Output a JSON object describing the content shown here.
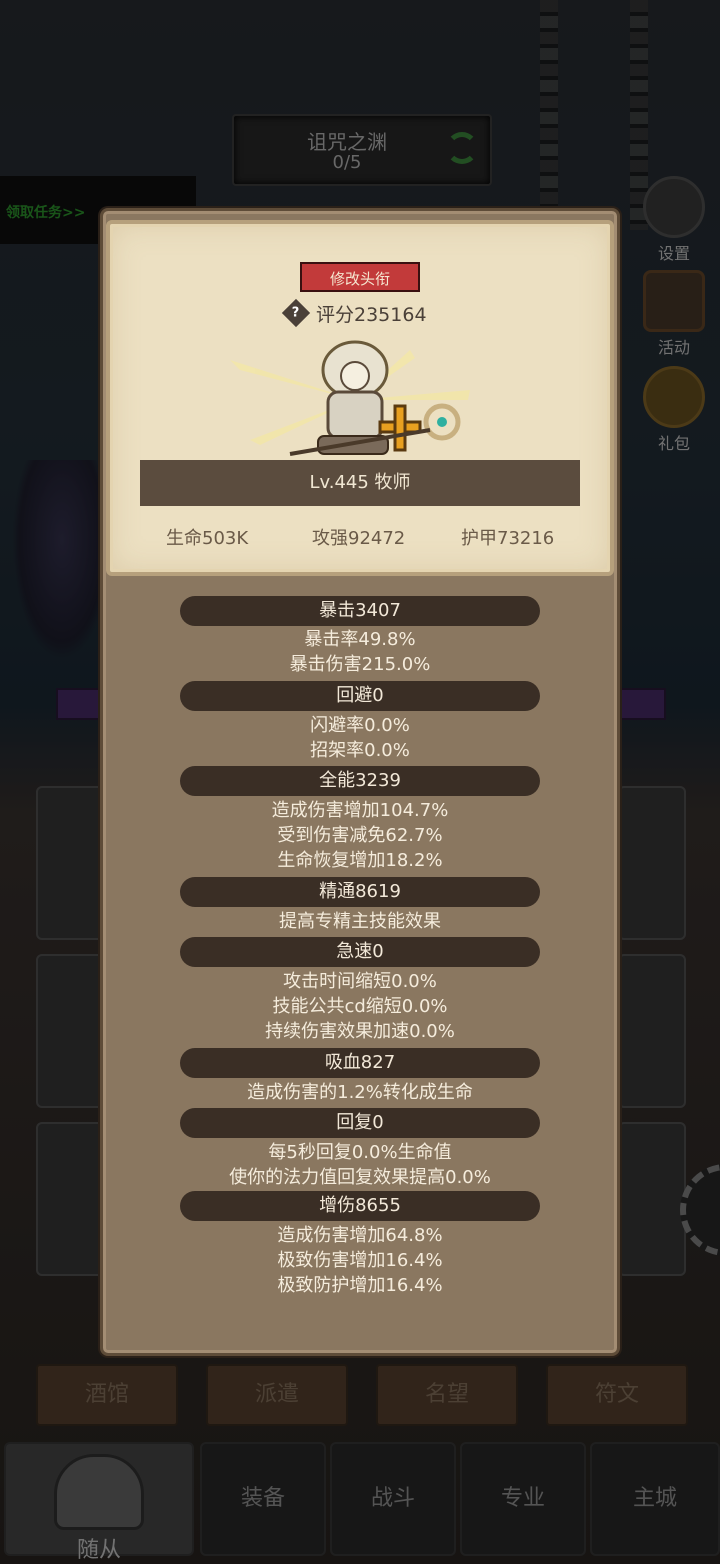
{
  "quest": {
    "title": "诅咒之渊",
    "progress": "0/5",
    "accept_label": "领取任务>>"
  },
  "side_menu": [
    {
      "label": "设置",
      "icon": "gear-icon"
    },
    {
      "label": "活动",
      "icon": "activity-icon"
    },
    {
      "label": "礼包",
      "icon": "gift-icon"
    }
  ],
  "hero": {
    "rename_label": "修改头衔",
    "score": "评分235164",
    "level_class": "Lv.445 牧师",
    "life": "生命503K",
    "attack": "攻强92472",
    "armor": "护甲73216"
  },
  "sections": [
    {
      "title": "暴击3407",
      "lines": [
        "暴击率49.8%",
        "暴击伤害215.0%"
      ]
    },
    {
      "title": "回避0",
      "lines": [
        "闪避率0.0%",
        "招架率0.0%"
      ]
    },
    {
      "title": "全能3239",
      "lines": [
        "造成伤害增加104.7%",
        "受到伤害减免62.7%",
        "生命恢复增加18.2%"
      ]
    },
    {
      "title": "精通8619",
      "lines": [
        "提高专精主技能效果"
      ]
    },
    {
      "title": "急速0",
      "lines": [
        "攻击时间缩短0.0%",
        "技能公共cd缩短0.0%",
        "持续伤害效果加速0.0%"
      ]
    },
    {
      "title": "吸血827",
      "lines": [
        "造成伤害的1.2%转化成生命"
      ]
    },
    {
      "title": "回复0",
      "lines": [
        "每5秒回复0.0%生命值",
        "使你的法力值回复效果提高0.0%"
      ]
    },
    {
      "title": "增伤8655",
      "lines": [
        "造成伤害增加64.8%",
        "极致伤害增加16.4%",
        "极致防护增加16.4%"
      ]
    }
  ],
  "sub_tabs": [
    "酒馆",
    "派遣",
    "名望",
    "符文"
  ],
  "bottom_nav": [
    {
      "label": "随从",
      "active": true
    },
    {
      "label": "装备",
      "active": false
    },
    {
      "label": "战斗",
      "active": false
    },
    {
      "label": "专业",
      "active": false
    },
    {
      "label": "主城",
      "active": false
    }
  ],
  "colors": {
    "panel": "#8a7760",
    "parchment": "#ece0c2",
    "section_bar": "#3a2e25",
    "rename_button": "#c23a3a"
  }
}
